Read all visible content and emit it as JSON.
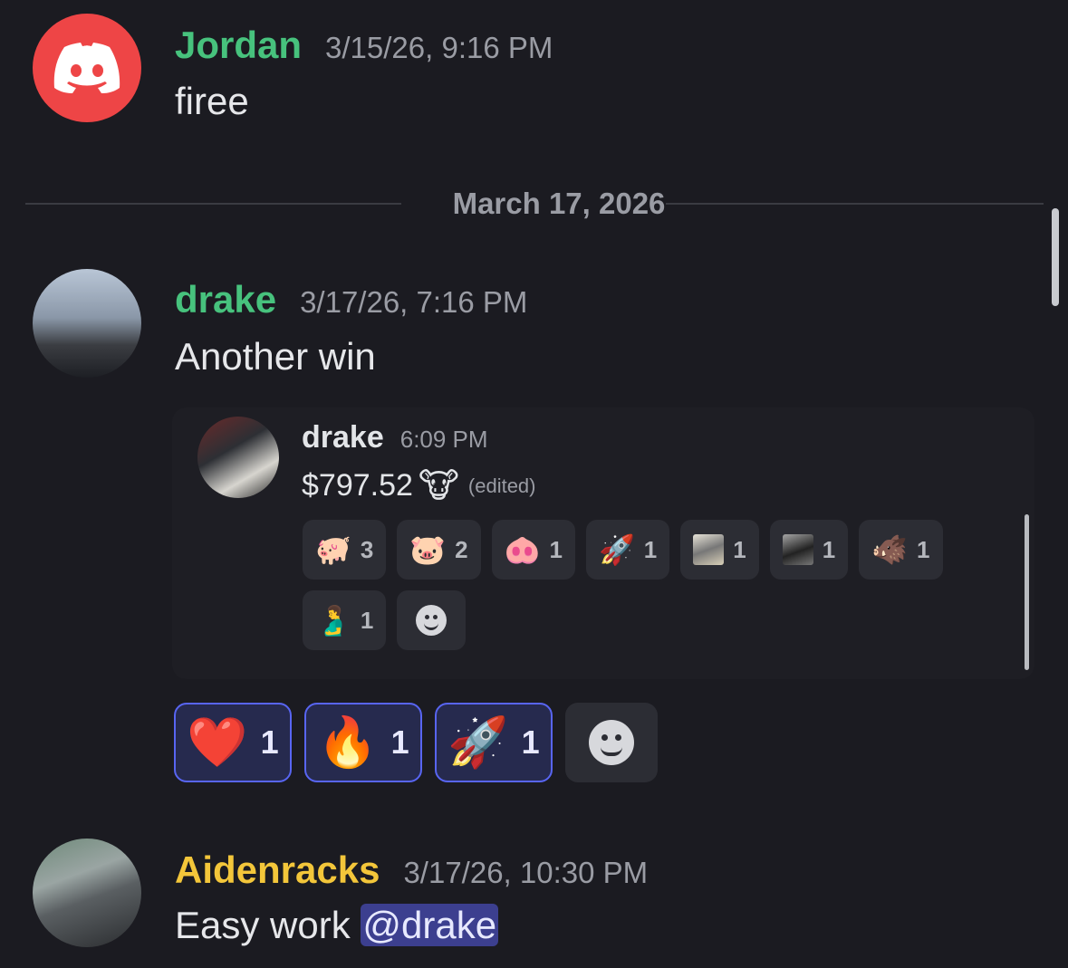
{
  "messages": [
    {
      "author": "Jordan",
      "timestamp": "3/15/26, 9:16 PM",
      "text": "firee",
      "avatar_icon": "discord-logo-icon"
    },
    {
      "author": "drake",
      "timestamp": "3/17/26, 7:16 PM",
      "text": "Another win",
      "avatar_icon": "user-photo"
    },
    {
      "author": "Aidenracks",
      "timestamp": "3/17/26, 10:30 PM",
      "text_before_mention": "Easy work ",
      "mention": "@drake",
      "avatar_icon": "user-photo"
    }
  ],
  "date_divider": "March 17, 2026",
  "forwarded": {
    "author": "drake",
    "time": "6:09 PM",
    "text": "$797.52",
    "emoji": "🐮",
    "edited_label": "(edited)",
    "reactions": [
      {
        "emoji": "🐖",
        "count": "3"
      },
      {
        "emoji": "🐷",
        "count": "2"
      },
      {
        "emoji": "🐽",
        "count": "1"
      },
      {
        "emoji": "🚀",
        "count": "1"
      },
      {
        "emoji": "custom-photo",
        "count": "1"
      },
      {
        "emoji": "custom-horse",
        "count": "1"
      },
      {
        "emoji": "🐗",
        "count": "1"
      },
      {
        "emoji": "🫃",
        "count": "1"
      }
    ]
  },
  "reactions": [
    {
      "emoji": "❤️",
      "count": "1"
    },
    {
      "emoji": "🔥",
      "count": "1"
    },
    {
      "emoji": "🚀",
      "count": "1"
    }
  ],
  "colors": {
    "background": "#1b1b21",
    "green_name": "#47c27d",
    "yellow_name": "#f3c63a",
    "mention_bg": "#3c3f8f",
    "reaction_border": "#5865f2"
  }
}
